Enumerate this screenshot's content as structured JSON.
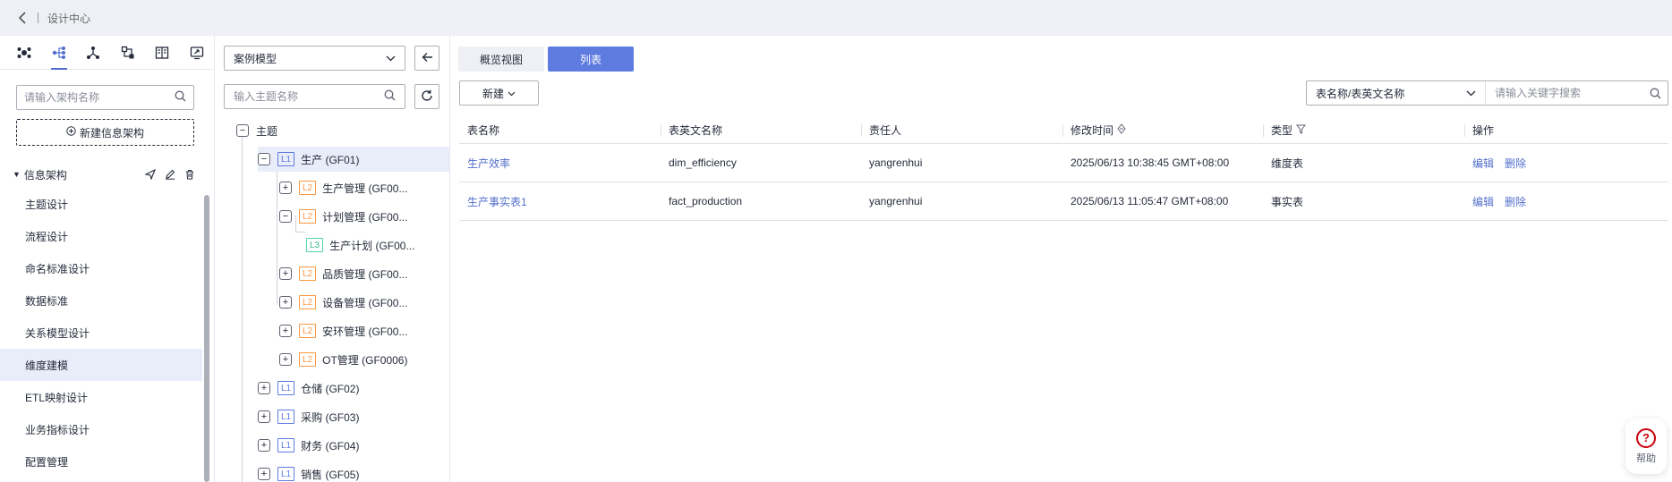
{
  "topbar": {
    "back_icon": "chevron-left-icon",
    "title": "设计中心"
  },
  "leftnav": {
    "icons": [
      "architecture-icon",
      "tree-icon",
      "relation-icon",
      "flow-icon",
      "book-icon",
      "monitor-icon"
    ],
    "search_placeholder": "请输入架构名称",
    "new_button": "新建信息架构",
    "section_title": "信息架构",
    "items": [
      {
        "label": "主题设计"
      },
      {
        "label": "流程设计"
      },
      {
        "label": "命名标准设计"
      },
      {
        "label": "数据标准"
      },
      {
        "label": "关系模型设计"
      },
      {
        "label": "维度建模",
        "active": true
      },
      {
        "label": "ETL映射设计"
      },
      {
        "label": "业务指标设计"
      },
      {
        "label": "配置管理"
      }
    ]
  },
  "tree": {
    "model_select": "案例模型",
    "search_placeholder": "输入主题名称",
    "root": "主题",
    "nodes": [
      {
        "level": "L1",
        "label": "生产 (GF01)",
        "toggle": "−",
        "selected": true
      },
      {
        "level": "L2",
        "label": "生产管理 (GF00...",
        "toggle": "+"
      },
      {
        "level": "L2",
        "label": "计划管理 (GF00...",
        "toggle": "−"
      },
      {
        "level": "L3",
        "label": "生产计划 (GF00..."
      },
      {
        "level": "L2",
        "label": "品质管理 (GF00...",
        "toggle": "+"
      },
      {
        "level": "L2",
        "label": "设备管理 (GF00...",
        "toggle": "+"
      },
      {
        "level": "L2",
        "label": "安环管理 (GF00...",
        "toggle": "+"
      },
      {
        "level": "L2",
        "label": "OT管理 (GF0006)",
        "toggle": "+"
      },
      {
        "level": "L1",
        "label": "仓储 (GF02)",
        "toggle": "+"
      },
      {
        "level": "L1",
        "label": "采购 (GF03)",
        "toggle": "+"
      },
      {
        "level": "L1",
        "label": "财务 (GF04)",
        "toggle": "+"
      },
      {
        "level": "L1",
        "label": "销售 (GF05)",
        "toggle": "+"
      }
    ]
  },
  "main": {
    "tabs": [
      "概览视图",
      "列表"
    ],
    "new_button": "新建",
    "filter_select": "表名称/表英文名称",
    "search_placeholder": "请输入关键字搜索",
    "columns": [
      "表名称",
      "表英文名称",
      "责任人",
      "修改时间",
      "类型",
      "操作"
    ],
    "rows": [
      {
        "name": "生产效率",
        "en_name": "dim_efficiency",
        "owner": "yangrenhui",
        "modified": "2025/06/13 10:38:45 GMT+08:00",
        "type": "维度表",
        "edit": "编辑",
        "delete": "删除"
      },
      {
        "name": "生产事实表1",
        "en_name": "fact_production",
        "owner": "yangrenhui",
        "modified": "2025/06/13 11:05:47 GMT+08:00",
        "type": "事实表",
        "edit": "编辑",
        "delete": "删除"
      }
    ]
  },
  "help": {
    "label": "帮助",
    "icon": "question-icon"
  },
  "colors": {
    "accent": "#5e7ce0",
    "link": "#526ecc",
    "l1": "#5e7ce0",
    "l2": "#fa9841",
    "l3": "#50d4ab"
  }
}
